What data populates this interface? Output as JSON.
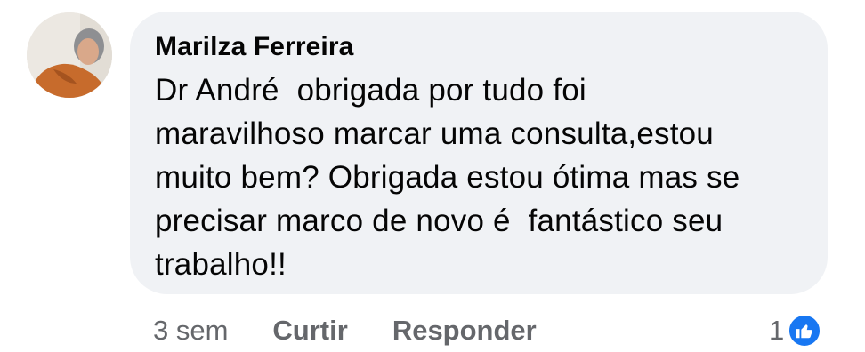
{
  "comment": {
    "author": "Marilza Ferreira",
    "text_lines": [
      "Dr André  obrigada por tudo foi",
      "maravilhoso marcar uma consulta,estou",
      "muito bem? Obrigada estou ótima mas se",
      "precisar marco de novo é  fantástico seu",
      "trabalho!!"
    ]
  },
  "actions": {
    "timestamp": "3 sem",
    "like_label": "Curtir",
    "reply_label": "Responder"
  },
  "reactions": {
    "count": "1",
    "icon": "like-icon",
    "color": "#1877f2"
  },
  "colors": {
    "bubble": "#f0f2f5",
    "text": "#050505",
    "secondary_text": "#65676b"
  }
}
